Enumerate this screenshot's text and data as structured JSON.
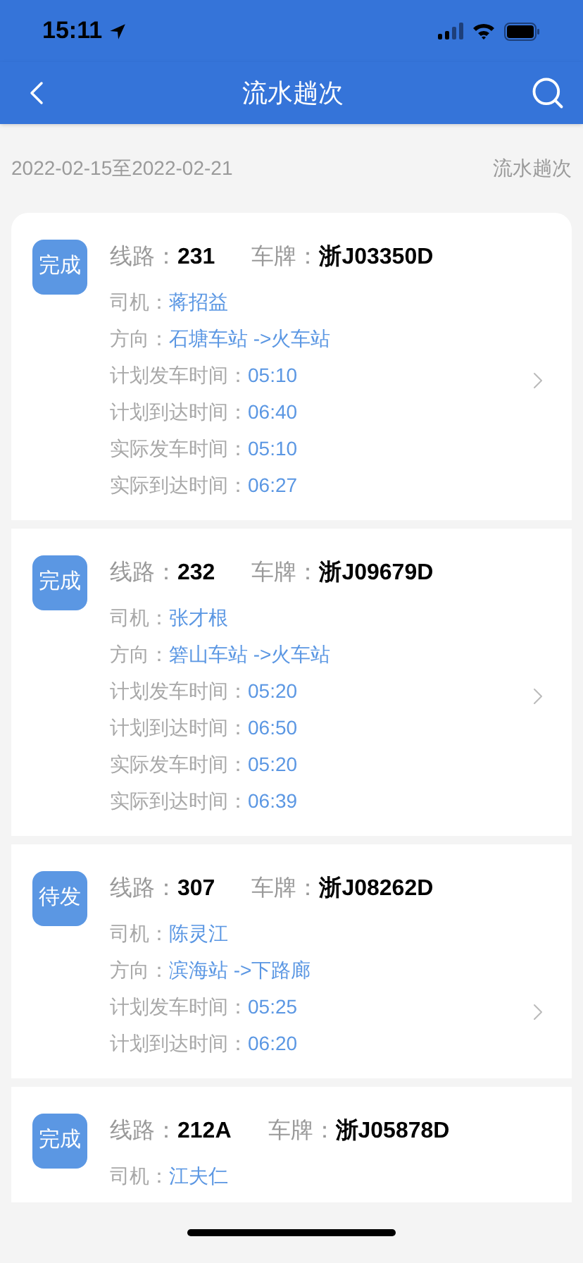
{
  "status_bar": {
    "time": "15:11"
  },
  "nav": {
    "title": "流水趟次"
  },
  "summary": {
    "date_range": "2022-02-15至2022-02-21",
    "label": "流水趟次"
  },
  "trips": [
    {
      "status": "完成",
      "line_label": "线路：",
      "line": "231",
      "plate_label": "车牌：",
      "plate": "浙J03350D",
      "fields": [
        {
          "label": "司机：",
          "value": "蒋招益"
        },
        {
          "label": "方向：",
          "value": "石塘车站 ->火车站"
        },
        {
          "label": "计划发车时间：",
          "value": "05:10"
        },
        {
          "label": "计划到达时间：",
          "value": "06:40"
        },
        {
          "label": "实际发车时间：",
          "value": "05:10"
        },
        {
          "label": "实际到达时间：",
          "value": "06:27"
        }
      ]
    },
    {
      "status": "完成",
      "line_label": "线路：",
      "line": "232",
      "plate_label": "车牌：",
      "plate": "浙J09679D",
      "fields": [
        {
          "label": "司机：",
          "value": "张才根"
        },
        {
          "label": "方向：",
          "value": "箬山车站 ->火车站"
        },
        {
          "label": "计划发车时间：",
          "value": "05:20"
        },
        {
          "label": "计划到达时间：",
          "value": "06:50"
        },
        {
          "label": "实际发车时间：",
          "value": "05:20"
        },
        {
          "label": "实际到达时间：",
          "value": "06:39"
        }
      ]
    },
    {
      "status": "待发",
      "line_label": "线路：",
      "line": "307",
      "plate_label": "车牌：",
      "plate": "浙J08262D",
      "fields": [
        {
          "label": "司机：",
          "value": "陈灵江"
        },
        {
          "label": "方向：",
          "value": "滨海站 ->下路廊"
        },
        {
          "label": "计划发车时间：",
          "value": "05:25"
        },
        {
          "label": "计划到达时间：",
          "value": "06:20"
        }
      ]
    },
    {
      "status": "完成",
      "line_label": "线路：",
      "line": "212A",
      "plate_label": "车牌：",
      "plate": "浙J05878D",
      "fields": [
        {
          "label": "司机：",
          "value": "江夫仁"
        }
      ]
    }
  ]
}
